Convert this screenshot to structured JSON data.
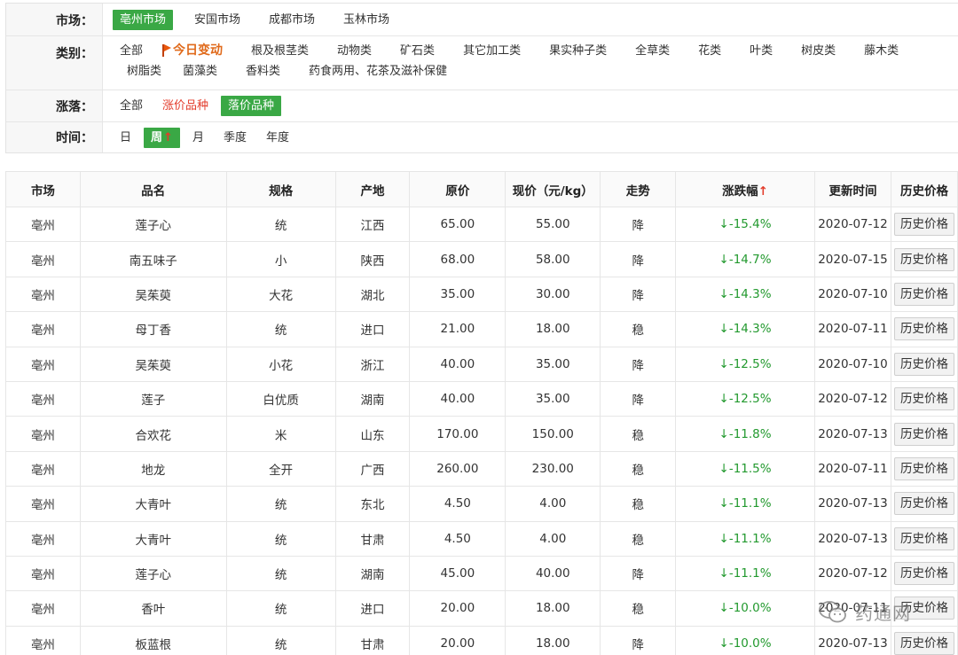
{
  "filters": {
    "market": {
      "label": "市场：",
      "options": [
        "亳州市场",
        "安国市场",
        "成都市场",
        "玉林市场"
      ],
      "active": "亳州市场"
    },
    "category": {
      "label": "类别：",
      "options": [
        "全部",
        "今日变动",
        "根及根茎类",
        "动物类",
        "矿石类",
        "其它加工类",
        "果实种子类",
        "全草类",
        "花类",
        "叶类",
        "树皮类",
        "藤木类",
        "树脂类",
        "菌藻类",
        "香料类",
        "药食两用、花茶及滋补保健"
      ],
      "hot": "今日变动"
    },
    "change": {
      "label": "涨落：",
      "options": [
        "全部",
        "涨价品种",
        "落价品种"
      ],
      "active": "落价品种",
      "red": "涨价品种"
    },
    "time": {
      "label": "时间：",
      "options": [
        "日",
        "周",
        "月",
        "季度",
        "年度"
      ],
      "active": "周",
      "active_arrow": "↑"
    }
  },
  "table": {
    "headers": [
      "市场",
      "品名",
      "规格",
      "产地",
      "原价",
      "现价（元/kg）",
      "走势",
      "涨跌幅",
      "更新时间",
      "历史价格"
    ],
    "sort_arrow": "↑",
    "button_label": "历史价格",
    "rows": [
      [
        "亳州",
        "莲子心",
        "统",
        "江西",
        "65.00",
        "55.00",
        "降",
        "↓-15.4%",
        "2020-07-12"
      ],
      [
        "亳州",
        "南五味子",
        "小",
        "陕西",
        "68.00",
        "58.00",
        "降",
        "↓-14.7%",
        "2020-07-15"
      ],
      [
        "亳州",
        "吴茱萸",
        "大花",
        "湖北",
        "35.00",
        "30.00",
        "降",
        "↓-14.3%",
        "2020-07-10"
      ],
      [
        "亳州",
        "母丁香",
        "统",
        "进口",
        "21.00",
        "18.00",
        "稳",
        "↓-14.3%",
        "2020-07-11"
      ],
      [
        "亳州",
        "吴茱萸",
        "小花",
        "浙江",
        "40.00",
        "35.00",
        "降",
        "↓-12.5%",
        "2020-07-10"
      ],
      [
        "亳州",
        "莲子",
        "白优质",
        "湖南",
        "40.00",
        "35.00",
        "降",
        "↓-12.5%",
        "2020-07-12"
      ],
      [
        "亳州",
        "合欢花",
        "米",
        "山东",
        "170.00",
        "150.00",
        "稳",
        "↓-11.8%",
        "2020-07-13"
      ],
      [
        "亳州",
        "地龙",
        "全开",
        "广西",
        "260.00",
        "230.00",
        "稳",
        "↓-11.5%",
        "2020-07-11"
      ],
      [
        "亳州",
        "大青叶",
        "统",
        "东北",
        "4.50",
        "4.00",
        "稳",
        "↓-11.1%",
        "2020-07-13"
      ],
      [
        "亳州",
        "大青叶",
        "统",
        "甘肃",
        "4.50",
        "4.00",
        "稳",
        "↓-11.1%",
        "2020-07-13"
      ],
      [
        "亳州",
        "莲子心",
        "统",
        "湖南",
        "45.00",
        "40.00",
        "降",
        "↓-11.1%",
        "2020-07-12"
      ],
      [
        "亳州",
        "香叶",
        "统",
        "进口",
        "20.00",
        "18.00",
        "稳",
        "↓-10.0%",
        "2020-07-11"
      ],
      [
        "亳州",
        "板蓝根",
        "统",
        "甘肃",
        "20.00",
        "18.00",
        "降",
        "↓-10.0%",
        "2020-07-13"
      ]
    ]
  },
  "watermark": {
    "text": "药通网",
    "icon": "wechat-icon"
  },
  "colors": {
    "accent_green": "#3aa845",
    "down_green": "#22992e",
    "up_red": "#e33b2a",
    "hot_orange": "#e06a1b"
  }
}
